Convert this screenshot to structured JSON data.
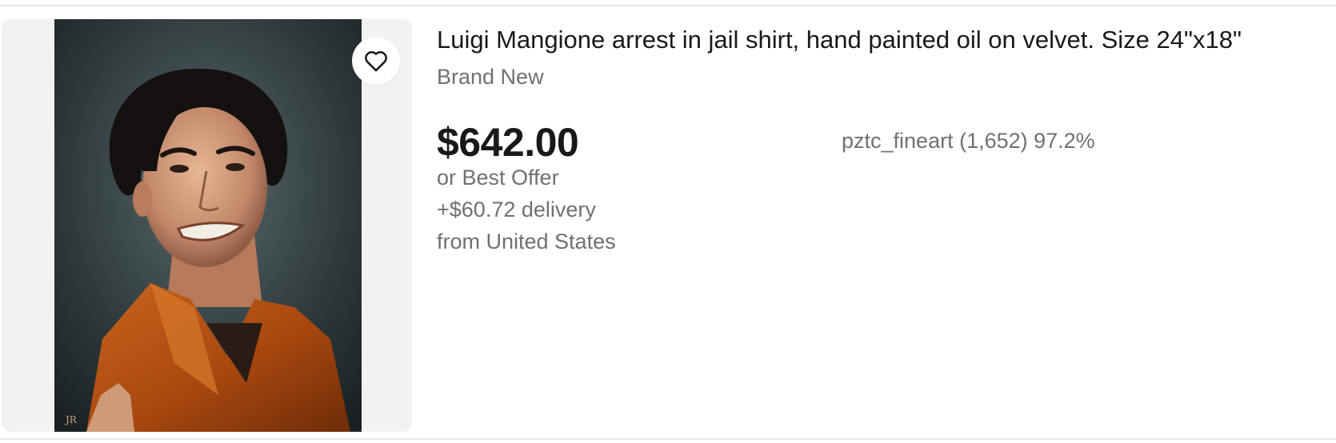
{
  "listing": {
    "title": "Luigi Mangione arrest in jail shirt, hand painted oil on velvet. Size 24\"x18\"",
    "condition": "Brand New",
    "price": "$642.00",
    "best_offer": "or Best Offer",
    "delivery": "+$60.72 delivery",
    "origin": "from United States",
    "seller": {
      "text": "pztc_fineart (1,652) 97.2%"
    },
    "image": {
      "description_icon": "listing-photo"
    },
    "watch_icon": "heart-icon"
  },
  "colors": {
    "text_primary": "#191919",
    "text_secondary": "#707070",
    "image_background": "#f2f2f2"
  }
}
